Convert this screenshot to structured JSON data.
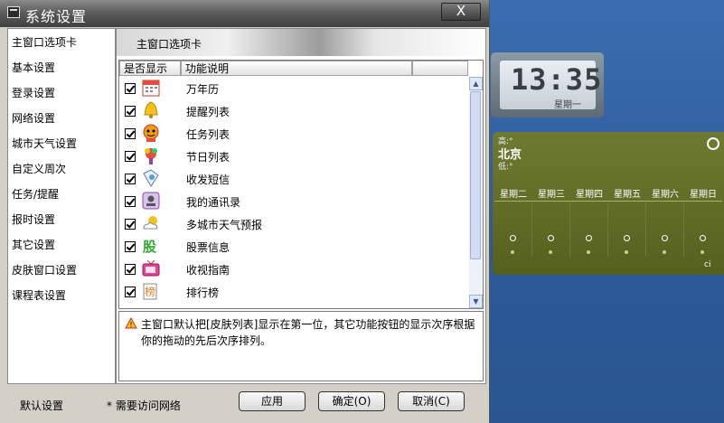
{
  "window": {
    "title": "系统设置",
    "close_label": "X"
  },
  "sidebar": {
    "items": [
      {
        "label": "主窗口选项卡"
      },
      {
        "label": "基本设置"
      },
      {
        "label": "登录设置"
      },
      {
        "label": "网络设置"
      },
      {
        "label": "城市天气设置"
      },
      {
        "label": "自定义周次"
      },
      {
        "label": "任务/提醒"
      },
      {
        "label": "报时设置"
      },
      {
        "label": "其它设置"
      },
      {
        "label": "皮肤窗口设置"
      },
      {
        "label": "课程表设置"
      }
    ]
  },
  "panel": {
    "header": "主窗口选项卡",
    "columns": [
      "是否显示",
      "功能说明"
    ],
    "rows": [
      {
        "label": "万年历",
        "checked": true,
        "icon": "calendar-icon"
      },
      {
        "label": "提醒列表",
        "checked": true,
        "icon": "bell-icon"
      },
      {
        "label": "任务列表",
        "checked": true,
        "icon": "task-icon"
      },
      {
        "label": "节日列表",
        "checked": true,
        "icon": "festival-icon"
      },
      {
        "label": "收发短信",
        "checked": true,
        "icon": "sms-icon"
      },
      {
        "label": "我的通讯录",
        "checked": true,
        "icon": "contacts-icon"
      },
      {
        "label": "多城市天气预报",
        "checked": true,
        "icon": "weather-icon"
      },
      {
        "label": "股票信息",
        "checked": true,
        "icon": "stock-icon"
      },
      {
        "label": "收视指南",
        "checked": true,
        "icon": "tv-icon"
      },
      {
        "label": "排行榜",
        "checked": true,
        "icon": "ranking-icon"
      }
    ],
    "info": "主窗口默认把[皮肤列表]显示在第一位，其它功能按钮的显示次序根据你的拖动的先后次序排列。"
  },
  "footer": {
    "default_label": "默认设置",
    "note": "* 需要访问网络",
    "apply": "应用",
    "ok": "确定(O)",
    "cancel": "取消(C)"
  },
  "clock": {
    "time": "13:35",
    "day": "星期一"
  },
  "weather": {
    "high": "高:°",
    "city": "北京",
    "low": "低:°",
    "days": [
      "星期二",
      "星期三",
      "星期四",
      "星期五",
      "星期六",
      "星期日"
    ]
  },
  "colors": {
    "desktop": "#2e5f9e",
    "weather_bg": "#5f6a26",
    "titlebar": "#4a4a4a"
  }
}
